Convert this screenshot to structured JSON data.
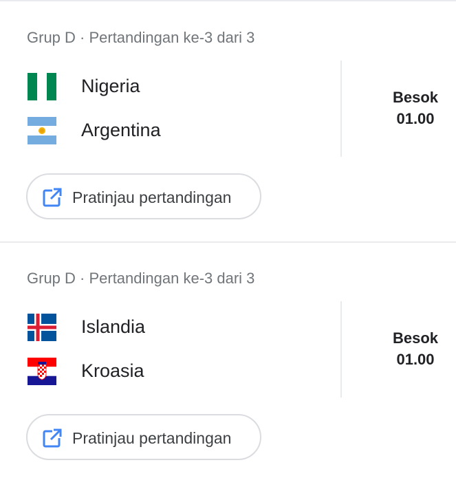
{
  "matches": [
    {
      "header": "Grup D · Pertandingan ke-3 dari 3",
      "teams": [
        {
          "name": "Nigeria",
          "flag_icon": "nigeria-flag-icon"
        },
        {
          "name": "Argentina",
          "flag_icon": "argentina-flag-icon"
        }
      ],
      "day": "Besok",
      "time": "01.00",
      "preview_label": "Pratinjau pertandingan"
    },
    {
      "header": "Grup D · Pertandingan ke-3 dari 3",
      "teams": [
        {
          "name": "Islandia",
          "flag_icon": "iceland-flag-icon"
        },
        {
          "name": "Kroasia",
          "flag_icon": "croatia-flag-icon"
        }
      ],
      "day": "Besok",
      "time": "01.00",
      "preview_label": "Pratinjau pertandingan"
    }
  ],
  "colors": {
    "accent": "#4285f4",
    "text_primary": "#202124",
    "text_secondary": "#70757a",
    "divider": "#e8eaed"
  }
}
